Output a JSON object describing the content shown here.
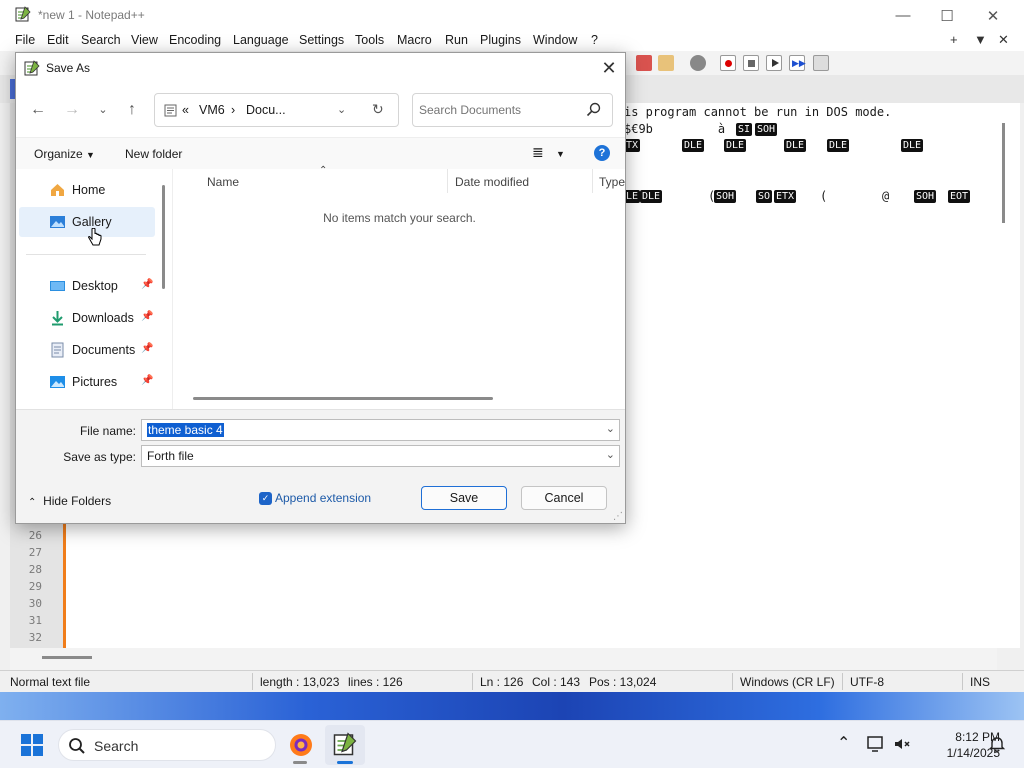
{
  "notepad": {
    "title": "*new 1 - Notepad++",
    "menu": [
      "File",
      "Edit",
      "Search",
      "View",
      "Encoding",
      "Language",
      "Settings",
      "Tools",
      "Macro",
      "Run",
      "Plugins",
      "Window",
      "?"
    ],
    "menu_right": [
      "+",
      "▼",
      "✕"
    ],
    "editor": {
      "text_lines": [
        "is program cannot be run in DOS mode.",
        "$€9b         à "
      ],
      "ctl_row1": [
        "SI",
        "SOH"
      ],
      "ctl_row2": [
        "TX",
        "DLE",
        "DLE",
        "DLE",
        "DLE",
        "DLE"
      ],
      "ctl_row3": [
        "LE",
        "DLE",
        "SOH",
        "SO",
        "ETX",
        "SOH",
        "EOT"
      ],
      "row3_chars": [
        "(",
        "(",
        "@"
      ],
      "line_numbers": [
        "26",
        "27",
        "28",
        "29",
        "30",
        "31",
        "32"
      ]
    },
    "status": {
      "file_type": "Normal text file",
      "length": "length : 13,023",
      "lines": "lines : 126",
      "ln": "Ln : 126",
      "col": "Col : 143",
      "pos": "Pos : 13,024",
      "eol": "Windows (CR LF)",
      "encoding": "UTF-8",
      "mode": "INS"
    }
  },
  "dialog": {
    "title": "Save As",
    "path": [
      "VM6",
      "Docu..."
    ],
    "path_prefix": "«",
    "path_sep": "›",
    "search_placeholder": "Search Documents",
    "organize_label": "Organize",
    "new_folder_label": "New folder",
    "nav_items": [
      {
        "label": "Home",
        "icon": "home-icon"
      },
      {
        "label": "Gallery",
        "icon": "gallery-icon"
      },
      {
        "label": "Desktop",
        "icon": "desktop-icon",
        "pinned": true
      },
      {
        "label": "Downloads",
        "icon": "downloads-icon",
        "pinned": true
      },
      {
        "label": "Documents",
        "icon": "documents-icon",
        "pinned": true
      },
      {
        "label": "Pictures",
        "icon": "pictures-icon",
        "pinned": true
      }
    ],
    "columns": [
      "Name",
      "Date modified",
      "Type"
    ],
    "empty_message": "No items match your search.",
    "file_name_label": "File name:",
    "file_name_value": "theme basic 4",
    "save_type_label": "Save as type:",
    "save_type_value": "Forth file",
    "hide_folders_label": "Hide Folders",
    "append_extension_label": "Append extension",
    "append_extension_checked": true,
    "save_label": "Save",
    "cancel_label": "Cancel"
  },
  "taskbar": {
    "search_label": "Search",
    "time": "8:12 PM",
    "date": "1/14/2025"
  },
  "colors": {
    "accent": "#0f5fd1",
    "fold_margin": "#f07d1a",
    "selection_bg": "#e6f0fb"
  }
}
